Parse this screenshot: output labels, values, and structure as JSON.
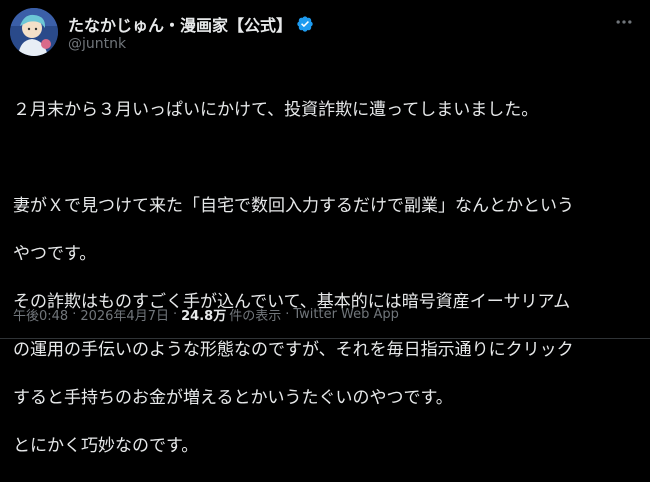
{
  "author": {
    "display_name": "たなかじゅん・漫画家【公式】",
    "handle": "@juntnk"
  },
  "icons": {
    "verified": "verified-badge-icon",
    "more": "more-options-icon"
  },
  "colors": {
    "background": "#000000",
    "text": "#e7e9ea",
    "secondary": "#71767b",
    "verified": "#1d9bf0"
  },
  "tweet": {
    "lines": [
      "２月末から３月いっぱいにかけて、投資詐欺に遭ってしまいました。",
      "",
      "妻がＸで見つけて来た「自宅で数回入力するだけで副業」なんとかという",
      "やつです。",
      "その詐欺はものすごく手が込んでいて、基本的には暗号資産イーサリアム",
      "の運用の手伝いのような形態なのですが、それを毎日指示通りにクリック",
      "すると手持ちのお金が増えるとかいうたぐいのやつです。",
      "とにかく巧妙なのです。"
    ]
  },
  "meta": {
    "time": "午後0:48",
    "date": "2026年4月7日",
    "views_count": "24.8万",
    "views_label": "件の表示",
    "source": "Twitter Web App",
    "separator": "·"
  }
}
